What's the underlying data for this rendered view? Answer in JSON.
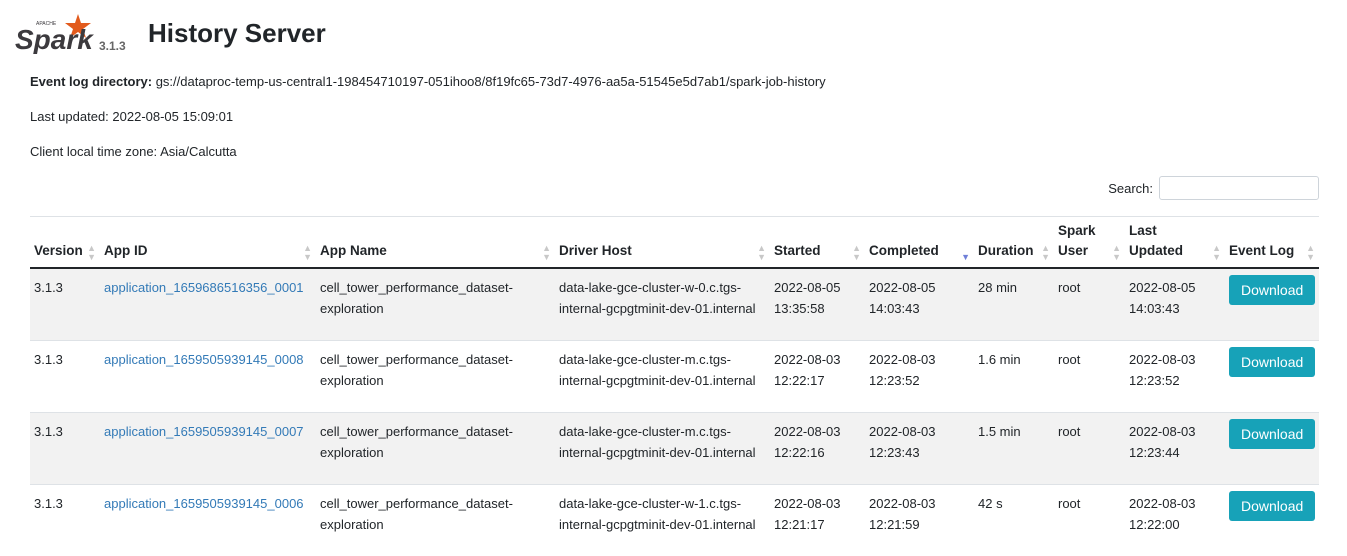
{
  "header": {
    "logo_small_text": "APACHE",
    "logo_text": "Spark",
    "version": "3.1.3",
    "title": "History Server"
  },
  "info": {
    "event_log_label": "Event log directory:",
    "event_log_value": "gs://dataproc-temp-us-central1-198454710197-051ihoo8/8f19fc65-73d7-4976-aa5a-51545e5d7ab1/spark-job-history",
    "last_updated": "Last updated: 2022-08-05 15:09:01",
    "time_zone": "Client local time zone: Asia/Calcutta"
  },
  "search": {
    "label": "Search:",
    "value": ""
  },
  "table": {
    "headers": {
      "version": "Version",
      "app_id": "App ID",
      "app_name": "App Name",
      "driver_host": "Driver Host",
      "started": "Started",
      "completed": "Completed",
      "duration": "Duration",
      "spark_user_1": "Spark",
      "spark_user_2": "User",
      "last_updated_1": "Last",
      "last_updated_2": "Updated",
      "event_log": "Event Log"
    },
    "rows": [
      {
        "version": "3.1.3",
        "app_id": "application_1659686516356_0001",
        "app_name": "cell_tower_performance_dataset-exploration",
        "driver_host": "data-lake-gce-cluster-w-0.c.tgs-internal-gcpgtminit-dev-01.internal",
        "started": "2022-08-05 13:35:58",
        "completed": "2022-08-05 14:03:43",
        "duration": "28 min",
        "user": "root",
        "last_updated": "2022-08-05 14:03:43",
        "event_log": "Download"
      },
      {
        "version": "3.1.3",
        "app_id": "application_1659505939145_0008",
        "app_name": "cell_tower_performance_dataset-exploration",
        "driver_host": "data-lake-gce-cluster-m.c.tgs-internal-gcpgtminit-dev-01.internal",
        "started": "2022-08-03 12:22:17",
        "completed": "2022-08-03 12:23:52",
        "duration": "1.6 min",
        "user": "root",
        "last_updated": "2022-08-03 12:23:52",
        "event_log": "Download"
      },
      {
        "version": "3.1.3",
        "app_id": "application_1659505939145_0007",
        "app_name": "cell_tower_performance_dataset-exploration",
        "driver_host": "data-lake-gce-cluster-m.c.tgs-internal-gcpgtminit-dev-01.internal",
        "started": "2022-08-03 12:22:16",
        "completed": "2022-08-03 12:23:43",
        "duration": "1.5 min",
        "user": "root",
        "last_updated": "2022-08-03 12:23:44",
        "event_log": "Download"
      },
      {
        "version": "3.1.3",
        "app_id": "application_1659505939145_0006",
        "app_name": "cell_tower_performance_dataset-exploration",
        "driver_host": "data-lake-gce-cluster-w-1.c.tgs-internal-gcpgtminit-dev-01.internal",
        "started": "2022-08-03 12:21:17",
        "completed": "2022-08-03 12:21:59",
        "duration": "42 s",
        "user": "root",
        "last_updated": "2022-08-03 12:22:00",
        "event_log": "Download"
      }
    ]
  },
  "colors": {
    "accent": "#17a2b8",
    "link": "#337ab7",
    "logo_orange": "#e25a1c",
    "logo_dark": "#3c3a3e"
  }
}
